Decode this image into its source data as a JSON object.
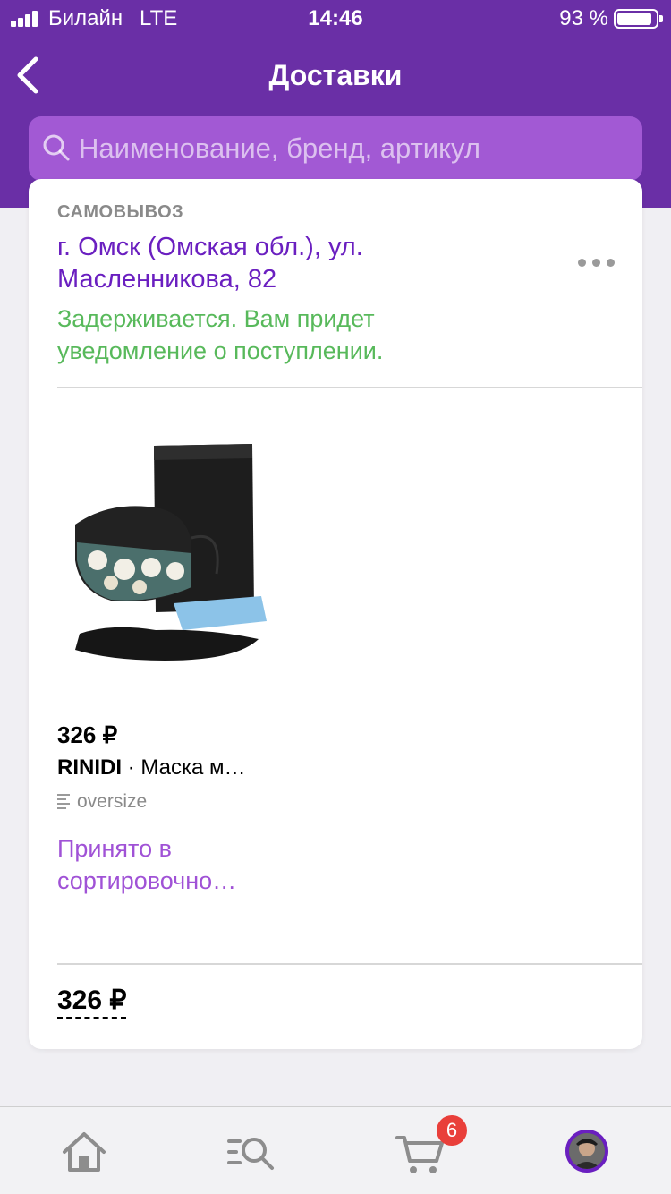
{
  "status_bar": {
    "carrier": "Билайн",
    "network": "LTE",
    "time": "14:46",
    "battery_pct": "93 %",
    "battery_level": 0.93
  },
  "header": {
    "title": "Доставки",
    "back_icon": "chevron-left-icon"
  },
  "search": {
    "placeholder": "Наименование, бренд, артикул",
    "icon": "search-icon"
  },
  "delivery": {
    "pickup_label": "САМОВЫВОЗ",
    "address": "г. Омск (Омская обл.), ул. Масленникова, 82",
    "delay_message": "Задерживается. Вам придет уведомление о поступлении."
  },
  "product": {
    "price": "326 ₽",
    "brand": "RINIDI",
    "separator": " · ",
    "name": "Маска м…",
    "size": "oversize",
    "status": "Принято в сортировочно…"
  },
  "total": "326 ₽",
  "tabbar": {
    "items": [
      "home-icon",
      "catalog-search-icon",
      "cart-icon",
      "profile-avatar"
    ],
    "cart_badge": "6"
  },
  "colors": {
    "header": "#6a2fa6",
    "search": "#a259d4",
    "address": "#6a1fc0",
    "delay": "#58b95b",
    "status": "#a052d6",
    "badge": "#e93f3a"
  }
}
